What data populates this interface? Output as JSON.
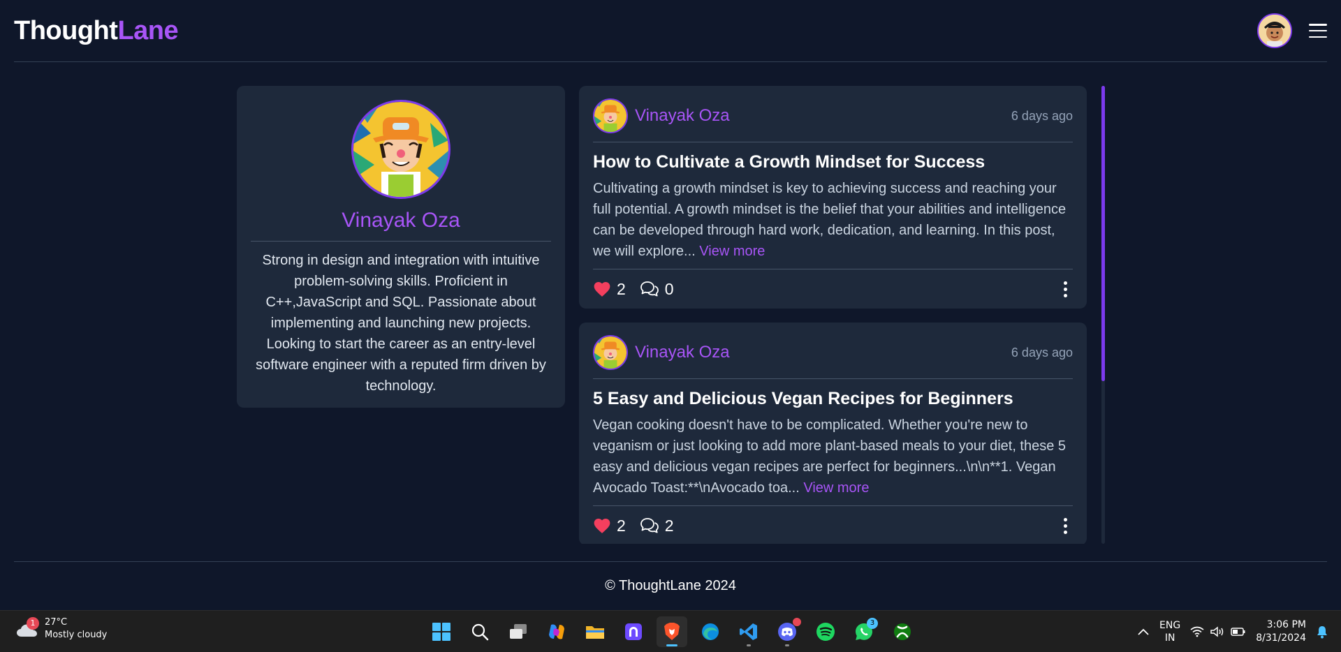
{
  "header": {
    "brand_part1": "Thought",
    "brand_part2": "Lane"
  },
  "profile": {
    "name": "Vinayak Oza",
    "bio": "Strong in design and integration with intuitive problem-solving skills. Proficient in C++,JavaScript and SQL. Passionate about implementing and launching new projects. Looking to start the career as an entry-level software engineer with a reputed firm driven by technology."
  },
  "posts": [
    {
      "author": "Vinayak Oza",
      "time": "6 days ago",
      "title": "How to Cultivate a Growth Mindset for Success",
      "excerpt": "Cultivating a growth mindset is key to achieving success and reaching your full potential. A growth mindset is the belief that your abilities and intelligence can be developed through hard work, dedication, and learning. In this post, we will explore...",
      "view_more": "View more",
      "likes": "2",
      "comments": "0"
    },
    {
      "author": "Vinayak Oza",
      "time": "6 days ago",
      "title": "5 Easy and Delicious Vegan Recipes for Beginners",
      "excerpt": "Vegan cooking doesn't have to be complicated. Whether you're new to veganism or just looking to add more plant-based meals to your diet, these 5 easy and delicious vegan recipes are perfect for beginners...\\n\\n**1. Vegan Avocado Toast:**\\nAvocado toa...",
      "view_more": "View more",
      "likes": "2",
      "comments": "2"
    }
  ],
  "footer": {
    "copyright": "© ThoughtLane 2024"
  },
  "taskbar": {
    "weather_badge": "1",
    "temperature": "27°C",
    "condition": "Mostly cloudy",
    "apps": [
      "start-icon",
      "search-icon",
      "task-view-icon",
      "copilot-icon",
      "file-explorer-icon",
      "proton-vpn-icon",
      "brave-icon",
      "edge-icon",
      "vscode-icon",
      "discord-icon",
      "spotify-icon",
      "whatsapp-icon",
      "xbox-icon"
    ],
    "whatsapp_badge": "3",
    "lang_line1": "ENG",
    "lang_line2": "IN",
    "time": "3:06 PM",
    "date": "8/31/2024"
  },
  "colors": {
    "background": "#0f172a",
    "card": "#1e293b",
    "accent": "#a855f7",
    "like": "#f43f5e"
  }
}
